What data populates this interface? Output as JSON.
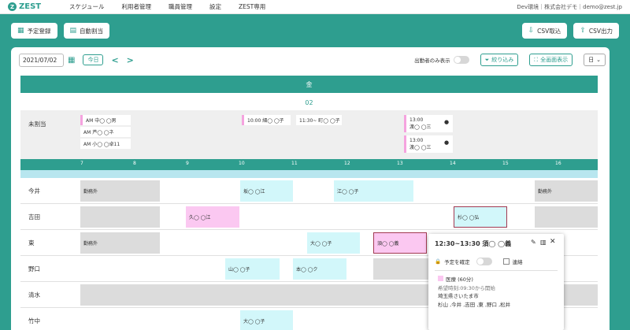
{
  "app": {
    "logo_text": "ZEST",
    "user": "Dev環境｜株式会社デモ｜demo@zest.jp"
  },
  "nav": [
    "スケジュール",
    "利用者管理",
    "職員管理",
    "設定",
    "ZEST専用"
  ],
  "toolbar": {
    "add": "予定登録",
    "auto": "自動割当",
    "csv_import": "CSV取込",
    "csv_export": "CSV出力"
  },
  "controls": {
    "date": "2021/07/02",
    "today": "今日",
    "only_label": "出勤者のみ表示",
    "filter": "絞り込み",
    "fullscreen": "全画面表示",
    "view": "日"
  },
  "day": {
    "weekday": "金",
    "date": "02"
  },
  "unassigned": {
    "label": "未割当",
    "cards": [
      "AM 中◯ ◯男",
      "AM 芦◯ ◯ネ",
      "AM 小◯ ◯卓11",
      "10:00 細◯ ◯子",
      "11:30~ 町◯ ◯子",
      "13:00\n渡◯ ◯三",
      "13:00\n渡◯ ◯三"
    ]
  },
  "hours": [
    "7",
    "8",
    "9",
    "10",
    "11",
    "12",
    "13",
    "14",
    "15",
    "16"
  ],
  "staff": [
    {
      "name": "今井",
      "blocks": [
        {
          "label": "勤務外"
        },
        {
          "label": "坂◯ ◯江"
        },
        {
          "label": "江◯ ◯子"
        },
        {
          "label": "勤務外"
        }
      ]
    },
    {
      "name": "吉田",
      "blocks": [
        {
          "label": "久◯ ◯江"
        },
        {
          "label": "杉◯ ◯弘"
        }
      ]
    },
    {
      "name": "東",
      "blocks": [
        {
          "label": "勤務外"
        },
        {
          "label": "大◯ ◯子"
        },
        {
          "label": "須◯ ◯義"
        }
      ]
    },
    {
      "name": "野口",
      "blocks": [
        {
          "label": "山◯ ◯子"
        },
        {
          "label": "本◯ ◯ク"
        }
      ]
    },
    {
      "name": "清水",
      "blocks": []
    },
    {
      "name": "竹中",
      "blocks": [
        {
          "label": "大◯ ◯子"
        }
      ]
    }
  ],
  "popup": {
    "title": "12:30~13:30 須◯ ◯義",
    "confirm": "予定を確定",
    "link": "連絡",
    "service": "医療",
    "duration": "(60分)",
    "wish": "希望時刻:09:30から開始",
    "address": "埼玉県さいたま市",
    "staff": "杉山 ,今井 ,吉田 ,東 ,野口 ,松井"
  },
  "colors": {
    "accent": "#2e9e8f",
    "pink": "#fbc8f1",
    "cyan": "#d2f7fa",
    "gray": "#dcdcdc"
  }
}
